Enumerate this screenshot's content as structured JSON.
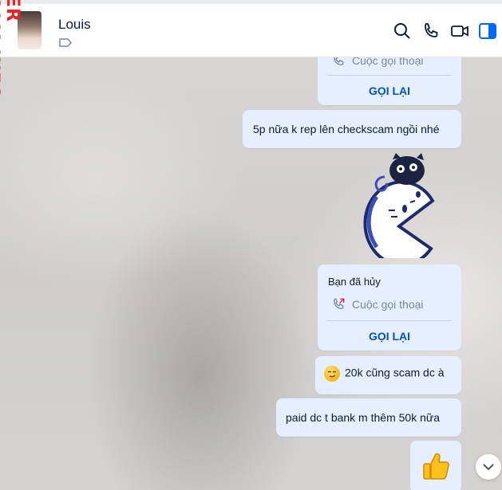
{
  "watermark": "ER CAM.INFO",
  "header": {
    "contact_name": "Louis"
  },
  "messages": {
    "top_call_partial": {
      "call_type": "Cuộc gọi thoại",
      "callback_label": "GỌI LẠI"
    },
    "msg1": "5p nữa k rep lên checkscam ngồi nhé",
    "call_card": {
      "title": "Bạn đã hủy",
      "call_type": "Cuộc gọi thoại",
      "callback_label": "GỌI LẠI"
    },
    "msg2": "20k cũng scam dc à",
    "msg3": "paid dc t bank m thêm 50k nữa"
  },
  "colors": {
    "bubble": "#e5efff",
    "accent": "#0050c8",
    "watermark": "#e8232a"
  }
}
